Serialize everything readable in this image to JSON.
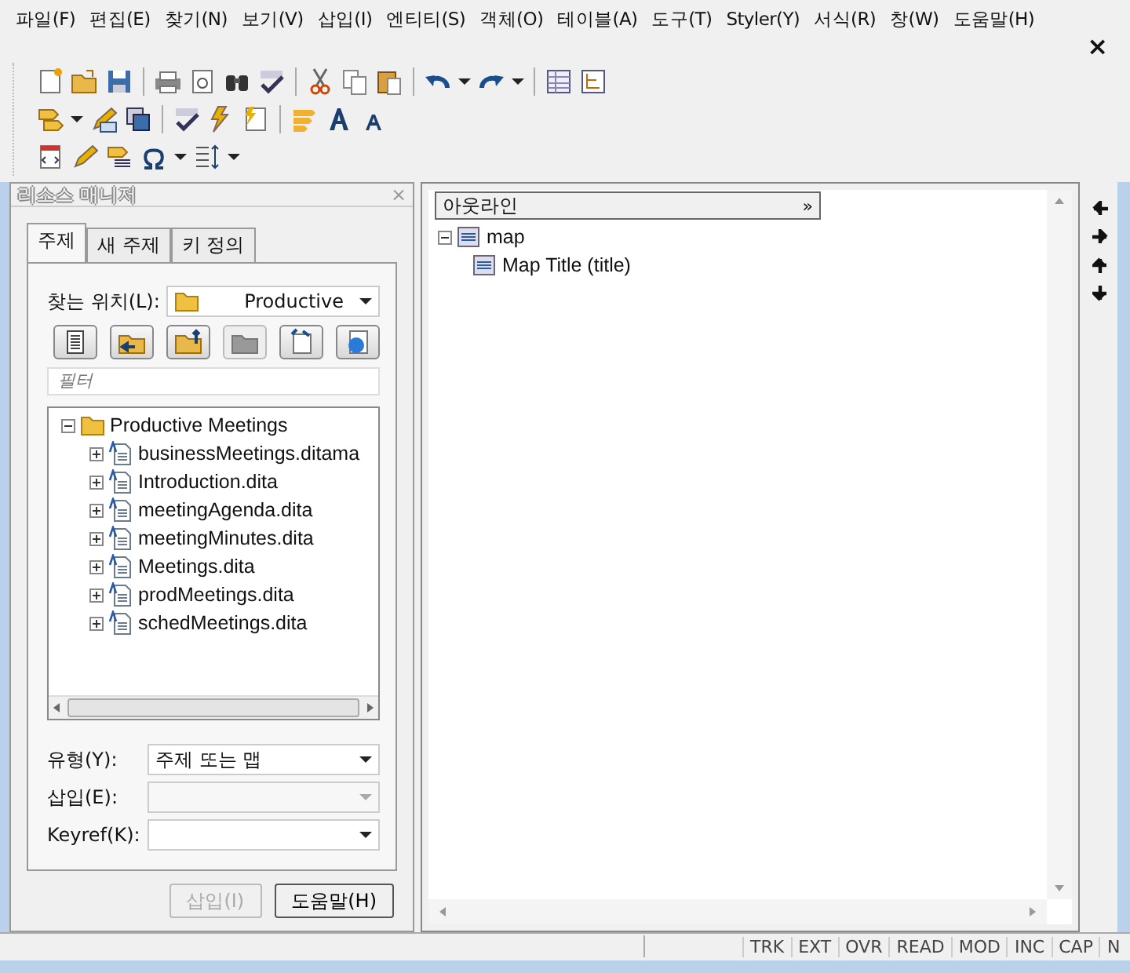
{
  "menu_bar": {
    "items": [
      "파일(F)",
      "편집(E)",
      "찾기(N)",
      "보기(V)",
      "삽입(I)",
      "엔티티(S)",
      "객체(O)",
      "테이블(A)",
      "도구(T)",
      "Styler(Y)",
      "서식(R)",
      "창(W)",
      "도움말(H)"
    ],
    "close": "×"
  },
  "resource_manager": {
    "title": "리소스 매니저",
    "close": "×",
    "tabs": [
      {
        "label": "주제",
        "selected": true
      },
      {
        "label": "새 주제",
        "selected": false
      },
      {
        "label": "키 정의",
        "selected": false
      }
    ],
    "location": {
      "label": "찾는 위치(L):",
      "value": "Productive"
    },
    "buttons": [
      {
        "disabled": false
      },
      {
        "disabled": false
      },
      {
        "disabled": false
      },
      {
        "disabled": true
      },
      {
        "disabled": false
      },
      {
        "disabled": false
      }
    ],
    "filter": {
      "placeholder": "필터"
    },
    "tree": [
      {
        "label": "Productive Meetings",
        "kind": "folder",
        "expanded": true,
        "children": [
          {
            "label": "businessMeetings.ditama",
            "kind": "file",
            "expanded": false
          },
          {
            "label": "Introduction.dita",
            "kind": "file",
            "expanded": false
          },
          {
            "label": "meetingAgenda.dita",
            "kind": "file",
            "expanded": false
          },
          {
            "label": "meetingMinutes.dita",
            "kind": "file",
            "expanded": false
          },
          {
            "label": "Meetings.dita",
            "kind": "file",
            "expanded": false
          },
          {
            "label": "prodMeetings.dita",
            "kind": "file",
            "expanded": false
          },
          {
            "label": "schedMeetings.dita",
            "kind": "file",
            "expanded": false
          }
        ]
      }
    ],
    "fields": [
      {
        "label": "유형(Y):",
        "value": "주제 또는 맵",
        "disabled": false
      },
      {
        "label": "삽입(E):",
        "disabled": true
      },
      {
        "label": "Keyref(K):",
        "disabled": false
      }
    ],
    "actions": [
      {
        "label": "삽입(I)",
        "disabled": true
      },
      {
        "label": "도움말(H)",
        "disabled": false
      }
    ]
  },
  "outline": {
    "title": "아웃라인",
    "more": "»",
    "tree": [
      {
        "label": "map",
        "expanded": true,
        "children": [
          {
            "label": "Map Title (title)"
          }
        ]
      }
    ]
  },
  "status_bar": {
    "indicators": [
      "TRK",
      "EXT",
      "OVR",
      "READ",
      "MOD",
      "INC",
      "CAP",
      "N"
    ]
  }
}
